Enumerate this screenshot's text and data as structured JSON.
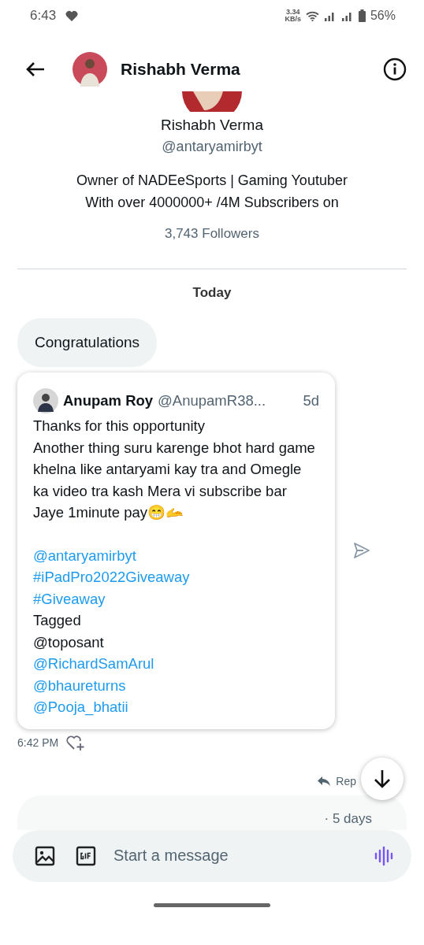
{
  "status_bar": {
    "time": "6:43",
    "speed": "3.34",
    "speed_unit": "KB/s",
    "battery": "56%"
  },
  "header": {
    "name": "Rishabh Verma"
  },
  "profile": {
    "name": "Rishabh Verma",
    "handle": "@antaryamirbyt",
    "bio": [
      "Owner of NADEeSports | Gaming Youtuber",
      "With over 4000000+ /4M Subscribers on"
    ],
    "followers": "3,743 Followers"
  },
  "day_label": "Today",
  "messages": [
    {
      "kind": "bubble",
      "text": "Congratulations"
    },
    {
      "kind": "tweet",
      "author": "Anupam Roy",
      "handle": "@AnupamR38...",
      "age": "5d",
      "lines": [
        {
          "kind": "text",
          "text": "Thanks for this opportunity"
        },
        {
          "kind": "text",
          "text": "Another thing suru karenge bhot hard game khelna like antaryami kay tra and Omegle ka video tra kash Mera vi subscribe bar Jaye 1minute pay😁🫴"
        },
        {
          "kind": "gap"
        },
        {
          "kind": "link",
          "text": "@antaryamirbyt"
        },
        {
          "kind": "link",
          "text": "#iPadPro2022Giveaway"
        },
        {
          "kind": "link",
          "text": "#Giveaway"
        },
        {
          "kind": "text",
          "text": "Tagged"
        },
        {
          "kind": "text",
          "text": "@toposant"
        },
        {
          "kind": "link",
          "text": "@RichardSamArul"
        },
        {
          "kind": "link",
          "text": "@bhaureturns"
        },
        {
          "kind": "link",
          "text": "@Pooja_bhatii"
        }
      ],
      "time": "6:42 PM"
    }
  ],
  "reply_label": "Rep",
  "next_preview": {
    "age": "· 5 days"
  },
  "composer": {
    "placeholder": "Start a message"
  }
}
